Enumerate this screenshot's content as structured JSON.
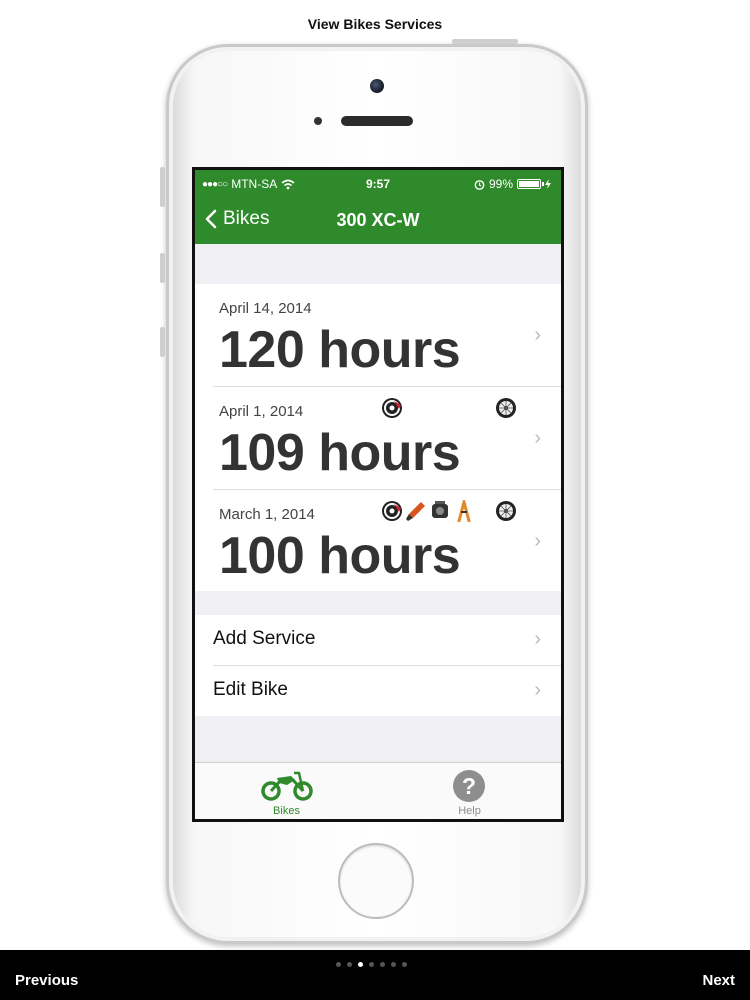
{
  "page": {
    "title": "View Bikes Services"
  },
  "status_bar": {
    "carrier": "MTN-SA",
    "time": "9:57",
    "battery": "99%"
  },
  "nav": {
    "back_label": "Bikes",
    "title": "300  XC-W"
  },
  "services": [
    {
      "date": "April 14, 2014",
      "hours": "120 hours",
      "icons": []
    },
    {
      "date": "April 1, 2014",
      "hours": "109 hours",
      "icons": [
        "brake-disc-icon",
        "wheel-icon"
      ]
    },
    {
      "date": "March 1, 2014",
      "hours": "100 hours",
      "icons": [
        "brake-disc-icon",
        "spark-plug-icon",
        "engine-icon",
        "suspension-fork-icon",
        "wheel-icon"
      ]
    }
  ],
  "menu": {
    "add_service": "Add Service",
    "edit_bike": "Edit Bike"
  },
  "tabs": [
    {
      "label": "Bikes",
      "icon": "motorbike-icon",
      "active": true
    },
    {
      "label": "Help",
      "icon": "help-icon",
      "active": false
    }
  ],
  "footer": {
    "previous": "Previous",
    "next": "Next",
    "pages": 7,
    "current_page": 3
  },
  "colors": {
    "nav_green": "#2f8a2c",
    "tab_active": "#2f8a2c",
    "tab_inactive": "#8e8e8e"
  }
}
